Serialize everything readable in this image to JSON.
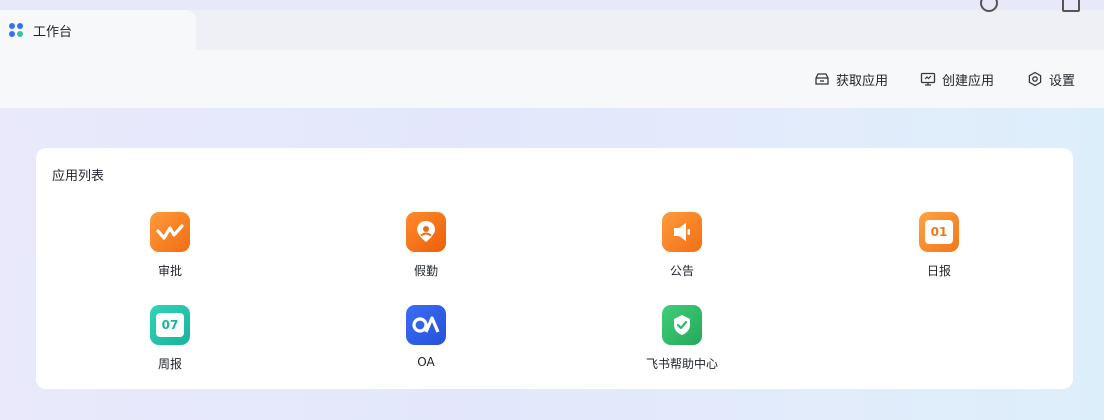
{
  "window": {
    "tab_title": "工作台"
  },
  "toolbar": {
    "get_apps_label": "获取应用",
    "create_app_label": "创建应用",
    "settings_label": "设置"
  },
  "app_list": {
    "title": "应用列表",
    "apps": [
      {
        "label": "审批",
        "icon": "approval-icon",
        "color": "#f7801d"
      },
      {
        "label": "假勤",
        "icon": "location-pin-icon",
        "color": "#f66f12"
      },
      {
        "label": "公告",
        "icon": "speaker-icon",
        "color": "#f57e1c"
      },
      {
        "label": "日报",
        "icon": "calendar-01-icon",
        "color": "#f6841f",
        "icon_text": "01"
      },
      {
        "label": "周报",
        "icon": "calendar-07-icon",
        "color": "#22c3aa",
        "icon_text": "07"
      },
      {
        "label": "OA",
        "icon": "oa-icon",
        "color": "#2f5de8"
      },
      {
        "label": "飞书帮助中心",
        "icon": "check-shield-icon",
        "color": "#2fb76a"
      }
    ]
  }
}
